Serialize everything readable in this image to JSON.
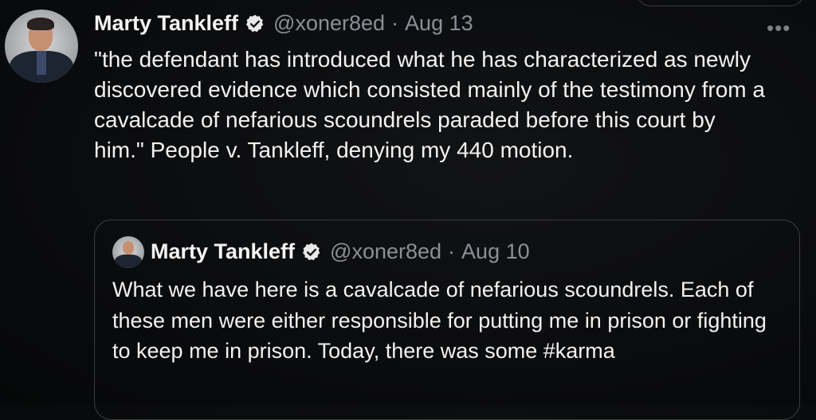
{
  "tweet": {
    "author_name": "Marty Tankleff",
    "handle": "@xoner8ed",
    "separator": "·",
    "date": "Aug 13",
    "more_label": "•••",
    "text": "\"the defendant has introduced what he has characterized as newly discovered evidence which consisted mainly of the testimony from a cavalcade of nefarious scoundrels paraded before this court by him.\" People v. Tankleff, denying my 440 motion."
  },
  "quoted_tweet": {
    "author_name": "Marty Tankleff",
    "handle": "@xoner8ed",
    "separator": "·",
    "date": "Aug 10",
    "text": "What we have here is a cavalcade of nefarious scoundrels. Each of these men were either responsible for putting me in prison or fighting to keep me in prison.  Today, there was some #karma"
  },
  "icons": {
    "verified": "verified-badge-icon",
    "more": "more-options-icon"
  },
  "colors": {
    "background": "#0b0c0e",
    "text": "#f2f2f2",
    "secondary_text": "#8b9096",
    "border": "#3a3d42"
  }
}
